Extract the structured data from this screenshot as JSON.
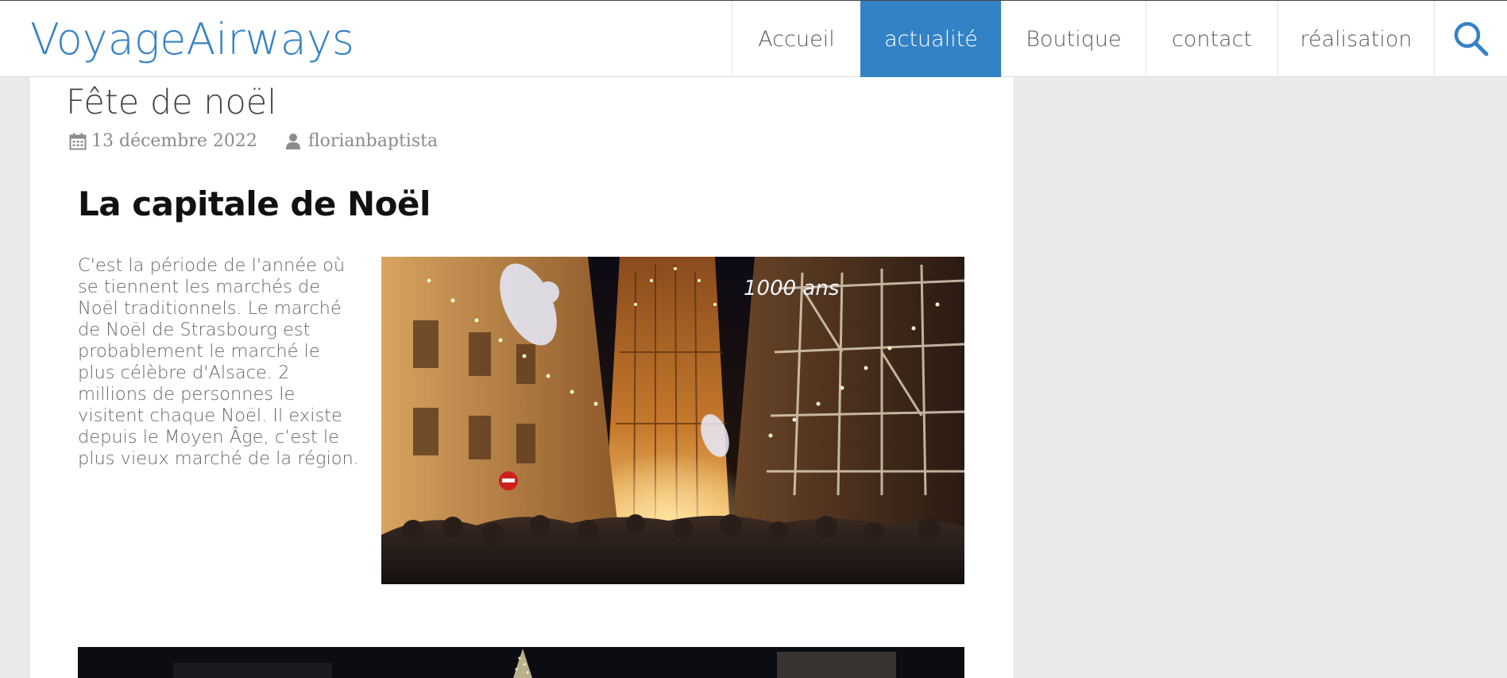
{
  "header": {
    "site_title": "VoyageAirways",
    "nav": [
      {
        "label": "Accueil",
        "active": false
      },
      {
        "label": "actualité",
        "active": true
      },
      {
        "label": "Boutique",
        "active": false
      },
      {
        "label": "contact",
        "active": false
      },
      {
        "label": "réalisation",
        "active": false
      }
    ],
    "search_icon": "search-icon"
  },
  "post": {
    "title": "Fête de noël",
    "date": "13 décembre 2022",
    "author": "florianbaptista",
    "date_icon": "calendar-icon",
    "author_icon": "user-icon",
    "heading": "La capitale de Noël",
    "intro": "C'est la période de l'année où se tiennent les marchés de Noël traditionnels. Le marché de Noël de Strasbourg est probablement le marché le plus célèbre d'Alsace. 2 millions de personnes le visitent chaque Noël. Il existe depuis le Moyen Âge, c’est le plus vieux marché de la région.",
    "photo_sign": "1000 ans"
  },
  "colors": {
    "accent": "#3482c6",
    "page_bg": "#e9e9e9"
  }
}
